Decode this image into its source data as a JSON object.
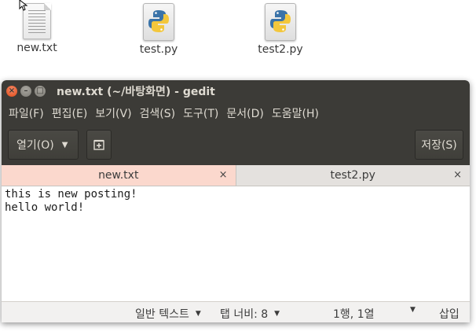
{
  "desktop": {
    "icons": [
      {
        "name": "new.txt",
        "type": "text"
      },
      {
        "name": "test.py",
        "type": "python"
      },
      {
        "name": "test2.py",
        "type": "python"
      }
    ]
  },
  "window": {
    "title": "new.txt (~/바탕화면) - gedit",
    "controls": {
      "close": "×",
      "minimize": "–",
      "maximize": "□"
    }
  },
  "menubar": {
    "items": [
      "파일(F)",
      "편집(E)",
      "보기(V)",
      "검색(S)",
      "도구(T)",
      "문서(D)",
      "도움말(H)"
    ]
  },
  "toolbar": {
    "open_label": "열기(O)",
    "open_arrow": "▼",
    "new_doc_icon": "new-document-icon",
    "save_label": "저장(S)"
  },
  "tabs": [
    {
      "label": "new.txt",
      "active": true,
      "close": "×"
    },
    {
      "label": "test2.py",
      "active": false,
      "close": "×"
    }
  ],
  "editor": {
    "lines": [
      "this is new posting!",
      "hello world!"
    ]
  },
  "statusbar": {
    "language": "일반 텍스트",
    "tab_width": "탭 너비: 8",
    "position": "1행, 1열",
    "mode": "삽입",
    "dropdown_arrow": "▼"
  },
  "colors": {
    "titlebar_bg": "#3c3b37",
    "active_tab_bg": "#fbd8cd",
    "close_button": "#df4a16"
  }
}
